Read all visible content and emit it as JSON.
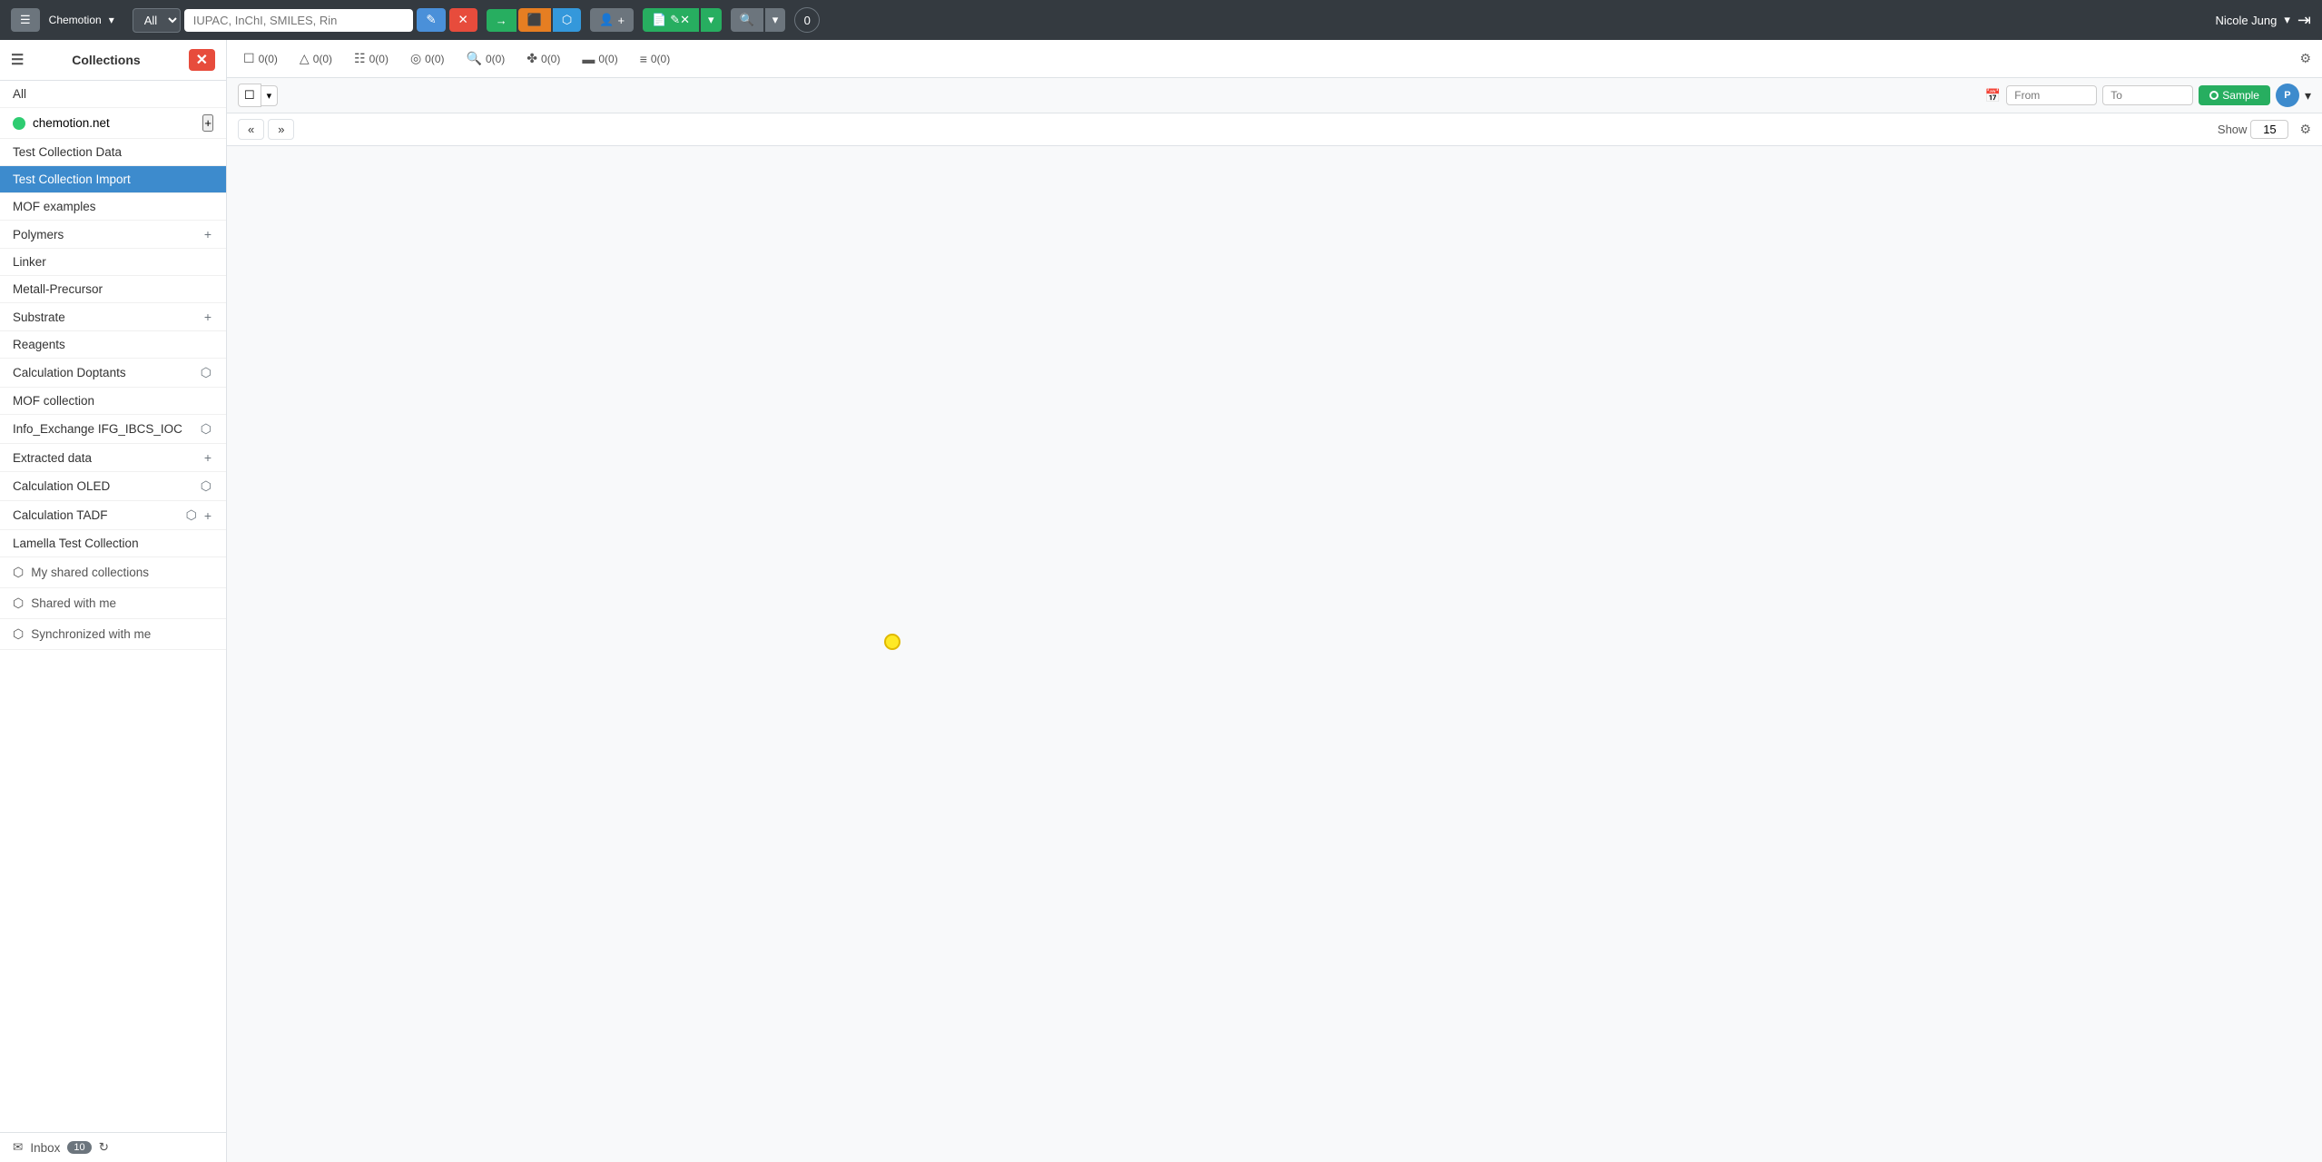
{
  "navbar": {
    "hamburger_icon": "☰",
    "brand": "Chemotion",
    "brand_arrow": "▾",
    "search_placeholder": "IUPAC, InChI, SMILES, Rin",
    "search_all_label": "All",
    "btn_edit_icon": "✎",
    "btn_delete_icon": "✕",
    "btn_create_arrow": "→",
    "btn_orange_icon": "⬛",
    "btn_share_icon": "⬡",
    "btn_user_icon": "👤",
    "btn_doc_icon": "📄",
    "btn_doc_edit": "✎✕",
    "btn_search_icon": "🔍",
    "btn_badge_count": "0",
    "user_name": "Nicole Jung",
    "user_arrow": "▾",
    "logout_icon": "⇥"
  },
  "sidebar": {
    "title": "Collections",
    "btn_add_icon": "✕",
    "all_label": "All",
    "chemotion_label": "chemotion.net",
    "items": [
      {
        "label": "Test Collection Data",
        "active": false,
        "has_add": false,
        "has_share": false
      },
      {
        "label": "Test Collection Import",
        "active": true,
        "has_add": false,
        "has_share": false
      },
      {
        "label": "MOF examples",
        "active": false,
        "has_add": false,
        "has_share": false
      },
      {
        "label": "Polymers",
        "active": false,
        "has_add": true,
        "has_share": false
      },
      {
        "label": "Linker",
        "active": false,
        "has_add": false,
        "has_share": false
      },
      {
        "label": "Metall-Precursor",
        "active": false,
        "has_add": false,
        "has_share": false
      },
      {
        "label": "Substrate",
        "active": false,
        "has_add": true,
        "has_share": false
      },
      {
        "label": "Reagents",
        "active": false,
        "has_add": false,
        "has_share": false
      },
      {
        "label": "Calculation Doptants",
        "active": false,
        "has_add": false,
        "has_share": true
      },
      {
        "label": "MOF collection",
        "active": false,
        "has_add": false,
        "has_share": false
      },
      {
        "label": "Info_Exchange IFG_IBCS_IOC",
        "active": false,
        "has_add": false,
        "has_share": true
      },
      {
        "label": "Extracted data",
        "active": false,
        "has_add": true,
        "has_share": false
      },
      {
        "label": "Calculation OLED",
        "active": false,
        "has_add": false,
        "has_share": true
      },
      {
        "label": "Calculation TADF",
        "active": false,
        "has_add": true,
        "has_share": true
      },
      {
        "label": "Lamella Test Collection",
        "active": false,
        "has_add": false,
        "has_share": false
      }
    ],
    "my_shared_collections": "My shared collections",
    "shared_with_me": "Shared with me",
    "synchronized_with_me": "Synchronized with me",
    "inbox_label": "Inbox",
    "inbox_count": "10",
    "inbox_refresh_icon": "↻",
    "inbox_icon": "✉"
  },
  "tabs": [
    {
      "icon": "☐",
      "count": "(0)"
    },
    {
      "icon": "△",
      "count": "(0)"
    },
    {
      "icon": "☷",
      "count": "(0)"
    },
    {
      "icon": "◎",
      "count": "(0)"
    },
    {
      "icon": "🔍",
      "count": "(0)"
    },
    {
      "icon": "✤",
      "count": "(0)"
    },
    {
      "icon": "▬",
      "count": "(0)"
    },
    {
      "icon": "≡",
      "count": "(0)"
    }
  ],
  "toolbar": {
    "from_placeholder": "From",
    "to_placeholder": "To",
    "sample_label": "Sample",
    "avatar_label": "P",
    "show_label": "Show",
    "show_value": "15"
  },
  "pagination": {
    "prev": "«",
    "next": "»"
  }
}
